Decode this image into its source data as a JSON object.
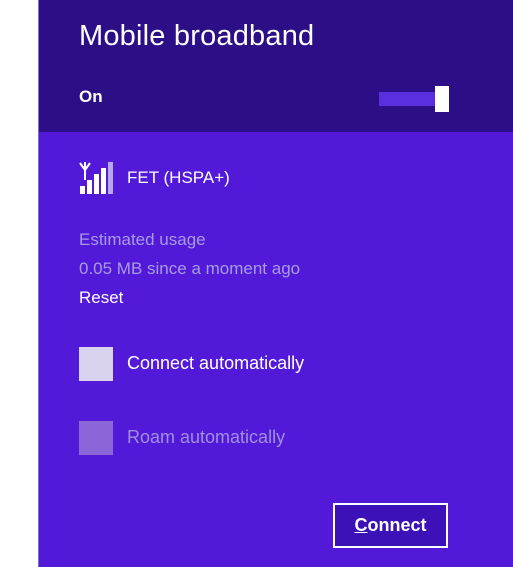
{
  "header": {
    "title": "Mobile broadband",
    "state_label": "On",
    "toggle_on": true
  },
  "network": {
    "icon": "signal-strength-icon",
    "name": "FET (HSPA+)"
  },
  "usage": {
    "label": "Estimated usage",
    "value": "0.05 MB since a moment ago",
    "reset_label": "Reset"
  },
  "options": {
    "connect_automatically": {
      "label": "Connect automatically",
      "checked": false
    },
    "roam_automatically": {
      "label": "Roam automatically",
      "checked": false,
      "disabled": true
    }
  },
  "actions": {
    "connect_mnemonic": "C",
    "connect_rest": "onnect"
  },
  "colors": {
    "header_bg": "#2c0f86",
    "panel_bg": "#5319d8",
    "muted_text": "#a89be6"
  }
}
